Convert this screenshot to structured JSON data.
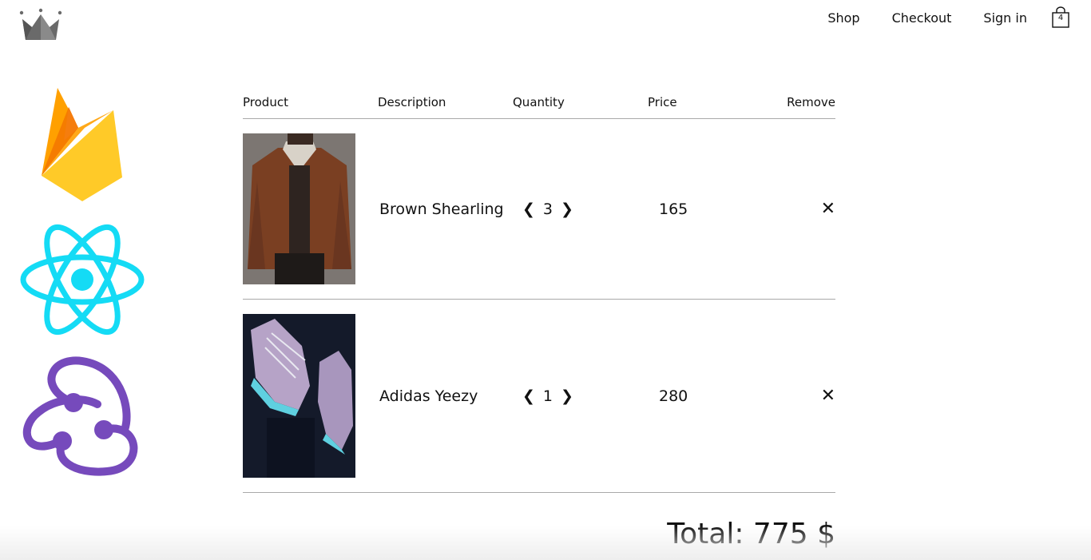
{
  "header": {
    "logo_icon": "crown-icon",
    "nav": [
      {
        "label": "Shop"
      },
      {
        "label": "Checkout"
      },
      {
        "label": "Sign in"
      }
    ],
    "cart": {
      "icon": "shopping-bag-icon",
      "count": "4"
    }
  },
  "tech_logos": [
    {
      "icon": "firebase-icon"
    },
    {
      "icon": "react-icon"
    },
    {
      "icon": "redux-icon"
    }
  ],
  "table": {
    "headers": {
      "product": "Product",
      "description": "Description",
      "quantity": "Quantity",
      "price": "Price",
      "remove": "Remove"
    },
    "items": [
      {
        "image": "brown-shearling-jacket-photo",
        "name": "Brown Shearling",
        "quantity": "3",
        "price": "165",
        "dec_icon": "❮",
        "inc_icon": "❯",
        "remove_icon": "✕"
      },
      {
        "image": "adidas-yeezy-sneakers-photo",
        "name": "Adidas Yeezy",
        "quantity": "1",
        "price": "280",
        "dec_icon": "❮",
        "inc_icon": "❯",
        "remove_icon": "✕"
      }
    ]
  },
  "total": {
    "label": "Total: 775 $"
  },
  "colors": {
    "firebase_orange": "#F57C00",
    "firebase_yellow": "#FFCA28",
    "react_cyan": "#14DBF5",
    "redux_purple": "#764ABC"
  }
}
